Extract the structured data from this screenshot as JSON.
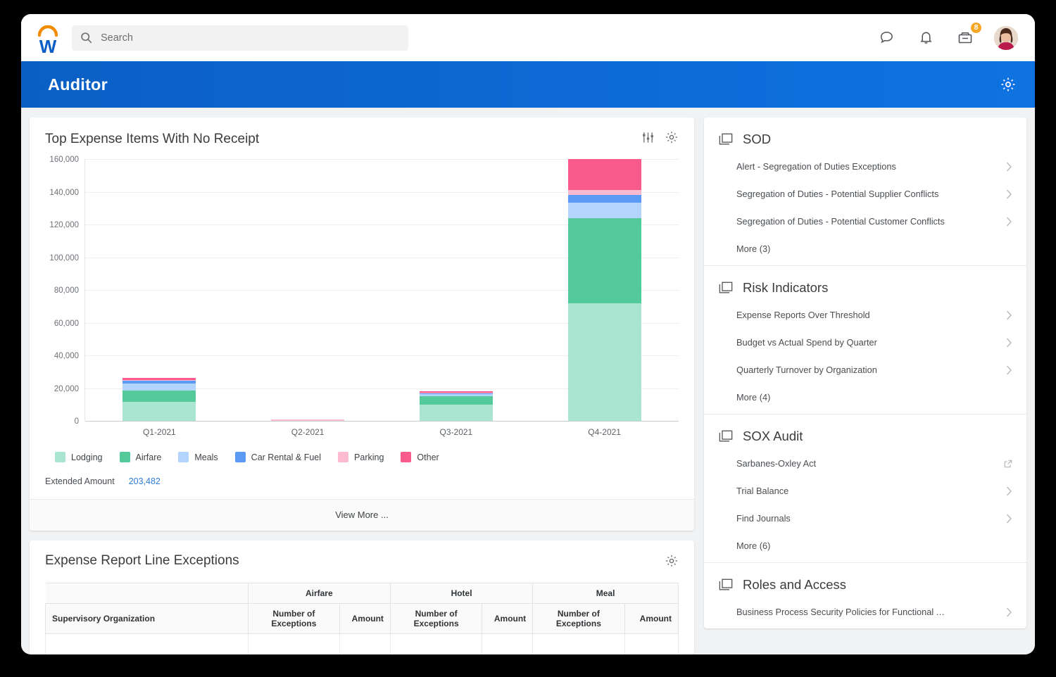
{
  "header": {
    "logo_icon": "workday-w-logo",
    "search": {
      "placeholder": "Search",
      "value": ""
    },
    "icons": [
      {
        "name": "chat-icon",
        "label": "Chat"
      },
      {
        "name": "bell-icon",
        "label": "Notifications"
      },
      {
        "name": "inbox-icon",
        "label": "Inbox",
        "badge": "8"
      }
    ],
    "avatar_label": "User profile"
  },
  "banner": {
    "title": "Auditor",
    "gear_icon": "gear-icon"
  },
  "chart_card": {
    "title": "Top Expense Items With No Receipt",
    "filter_icon": "filter-sliders-icon",
    "gear_icon": "gear-icon",
    "summary_label": "Extended Amount",
    "summary_value": "203,482",
    "view_more": "View More ..."
  },
  "chart_data": {
    "type": "bar",
    "stacked": true,
    "title": "Top Expense Items With No Receipt",
    "xlabel": "",
    "ylabel": "",
    "grid": true,
    "legend_position": "bottom",
    "categories": [
      "Q1-2021",
      "Q2-2021",
      "Q3-2021",
      "Q4-2021"
    ],
    "ylim": [
      0,
      160000
    ],
    "yticks": [
      0,
      20000,
      40000,
      60000,
      80000,
      100000,
      120000,
      140000,
      160000
    ],
    "ytick_labels": [
      "0",
      "20,000",
      "40,000",
      "60,000",
      "80,000",
      "100,000",
      "120,000",
      "140,000",
      "160,000"
    ],
    "series": [
      {
        "name": "Lodging",
        "color": "#aae5d2",
        "values": [
          11500,
          0,
          9800,
          72000
        ]
      },
      {
        "name": "Airfare",
        "color": "#54c99a",
        "values": [
          6800,
          0,
          5400,
          52000
        ]
      },
      {
        "name": "Meals",
        "color": "#b3d4fd",
        "values": [
          4700,
          0,
          1100,
          9500
        ]
      },
      {
        "name": "Car Rental & Fuel",
        "color": "#5b9bf5",
        "values": [
          1400,
          0,
          500,
          4500
        ]
      },
      {
        "name": "Parking",
        "color": "#fcbbd0",
        "values": [
          400,
          700,
          400,
          3200
        ]
      },
      {
        "name": "Other",
        "color": "#fa5a8c",
        "values": [
          1400,
          0,
          900,
          18800
        ]
      }
    ]
  },
  "table_card": {
    "title": "Expense Report Line Exceptions",
    "gear_icon": "gear-icon",
    "group_headers": [
      "",
      "Airfare",
      "Hotel",
      "Meal"
    ],
    "columns": [
      "Supervisory Organization",
      "Number of Exceptions",
      "Amount",
      "Number of Exceptions",
      "Amount",
      "Number of Exceptions",
      "Amount"
    ],
    "rows": []
  },
  "rail": {
    "sections": [
      {
        "title": "SOD",
        "icon": "copy-stack-icon",
        "items": [
          {
            "label": "Alert - Segregation of Duties Exceptions",
            "affordance": "chevron"
          },
          {
            "label": "Segregation of Duties - Potential Supplier Conflicts",
            "affordance": "chevron"
          },
          {
            "label": "Segregation of Duties - Potential Customer Conflicts",
            "affordance": "chevron"
          },
          {
            "label": "More (3)",
            "affordance": "none"
          }
        ]
      },
      {
        "title": "Risk Indicators",
        "icon": "copy-stack-icon",
        "items": [
          {
            "label": "Expense Reports Over Threshold",
            "affordance": "chevron"
          },
          {
            "label": "Budget vs Actual Spend by Quarter",
            "affordance": "chevron"
          },
          {
            "label": "Quarterly Turnover by Organization",
            "affordance": "chevron"
          },
          {
            "label": "More (4)",
            "affordance": "none"
          }
        ]
      },
      {
        "title": "SOX Audit",
        "icon": "copy-stack-icon",
        "items": [
          {
            "label": "Sarbanes-Oxley Act",
            "affordance": "external"
          },
          {
            "label": "Trial Balance",
            "affordance": "chevron"
          },
          {
            "label": "Find Journals",
            "affordance": "chevron"
          },
          {
            "label": "More (6)",
            "affordance": "none"
          }
        ]
      },
      {
        "title": "Roles and Access",
        "icon": "copy-stack-icon",
        "items": [
          {
            "label": "Business Process Security Policies for Functional Ar...",
            "affordance": "chevron"
          }
        ]
      }
    ]
  },
  "colors": {
    "banner_blue": "#0d6ad6",
    "link_blue": "#2f7bd6",
    "badge_orange": "#f5a623",
    "page_bg": "#f1f2f3"
  }
}
